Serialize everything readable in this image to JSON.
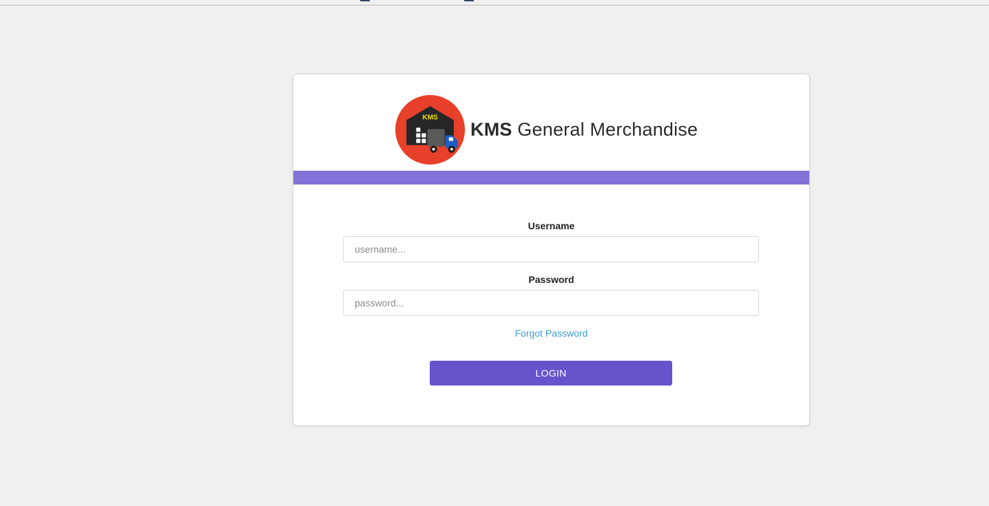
{
  "brand": {
    "name_bold": "KMS",
    "name_rest": " General Merchandise",
    "logo_text": "KMS",
    "logo_icon": "warehouse-truck-logo"
  },
  "form": {
    "username_label": "Username",
    "username_placeholder": "username...",
    "username_value": "",
    "password_label": "Password",
    "password_placeholder": "password...",
    "password_value": "",
    "forgot_link": "Forgot Password",
    "login_button": "LOGIN"
  },
  "colors": {
    "page_background": "#f0f0f0",
    "accent_bar": "#8272d8",
    "login_button": "#6654cc",
    "link": "#3a9fd6",
    "logo_circle": "#e8402a"
  }
}
